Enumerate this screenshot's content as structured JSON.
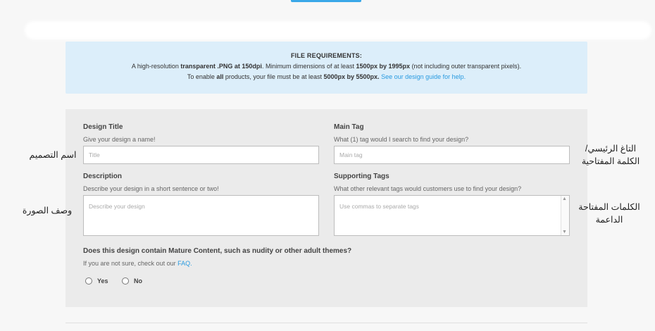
{
  "requirements": {
    "title": "FILE REQUIREMENTS:",
    "line1_a": "A high-resolution ",
    "line1_b": "transparent .PNG at 150dpi",
    "line1_c": ". Minimum dimensions of at least ",
    "line1_d": "1500px by 1995px",
    "line1_e": " (not including outer transparent pixels).",
    "line2_a": "To enable ",
    "line2_b": "all",
    "line2_c": " products, your file must be at least ",
    "line2_d": "5000px by 5500px.",
    "line2_link": "See our design guide for help."
  },
  "form": {
    "design_title": {
      "label": "Design Title",
      "hint": "Give your design a name!",
      "placeholder": "Title"
    },
    "main_tag": {
      "label": "Main Tag",
      "hint": "What (1) tag would I search to find your design?",
      "placeholder": "Main tag"
    },
    "description": {
      "label": "Description",
      "hint": "Describe your design in a short sentence or two!",
      "placeholder": "Describe your design"
    },
    "supporting_tags": {
      "label": "Supporting Tags",
      "hint": "What other relevant tags would customers use to find your design?",
      "placeholder": "Use commas to separate tags"
    },
    "mature": {
      "question": "Does this design contain Mature Content, such as nudity or other adult themes?",
      "hint": "If you are not sure, check out our ",
      "faq": "FAQ.",
      "yes": "Yes",
      "no": "No"
    }
  },
  "annotations": {
    "design_title_ar": "اسم التصميم",
    "main_tag_ar_1": "التاغ الرئيسي/",
    "main_tag_ar_2": "الكلمة المفتاحية",
    "description_ar": "وصف الصورة",
    "supporting_tags_ar_1": "الكلمات المفتاحة",
    "supporting_tags_ar_2": "الداعمة"
  },
  "icons": {
    "scroll_up": "triangle-up-icon",
    "scroll_down": "triangle-down-icon"
  },
  "colors": {
    "accent": "#2a9be0",
    "info_bg": "#dceefa",
    "form_bg": "#ebebeb"
  }
}
